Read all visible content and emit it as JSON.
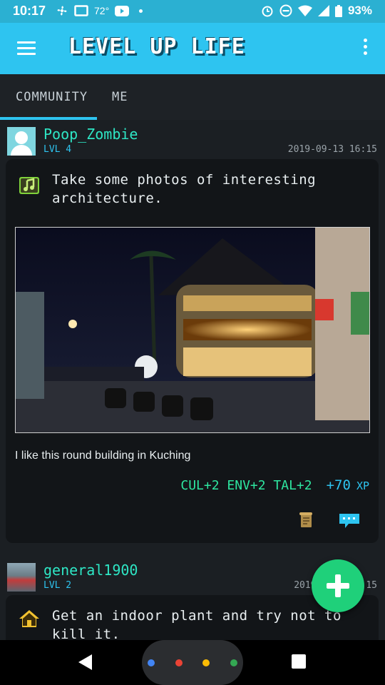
{
  "status_bar": {
    "time": "10:17",
    "temperature": "72°",
    "battery": "93%",
    "icons": [
      "fan-icon",
      "cast-icon",
      "youtube-icon",
      "dot-icon",
      "alarm-icon",
      "dnd-icon",
      "wifi-icon",
      "signal-icon",
      "battery-icon"
    ]
  },
  "app_bar": {
    "title": "LEVEL UP LIFE",
    "menu_icon": "menu-icon",
    "overflow_icon": "more-vert-icon"
  },
  "tabs": [
    {
      "label": "COMMUNITY",
      "selected": true
    },
    {
      "label": "ME",
      "selected": false
    }
  ],
  "posts": [
    {
      "username": "Poop_Zombie",
      "level": "LVL 4",
      "timestamp": "2019-09-13 16:15",
      "quest_icon": "music-note-icon",
      "quest_title": "Take some photos of interesting architecture.",
      "caption": "I like this round building in Kuching",
      "stats": "CUL+2 ENV+2 TAL+2",
      "xp_value": "+70",
      "xp_unit": "XP"
    },
    {
      "username": "general1900",
      "level": "LVL 2",
      "timestamp": "2019-",
      "timestamp_tail": "15",
      "quest_icon": "house-icon",
      "quest_title": "Get an indoor plant and try not to kill it."
    }
  ],
  "fab": {
    "icon": "add-icon"
  },
  "colors": {
    "status_bar": "#2bb0d2",
    "app_bar": "#2ec4f0",
    "background": "#1b1f23",
    "card": "#121518",
    "username": "#2ee6c5",
    "stats": "#2ee6a0",
    "fab": "#1fd07a"
  },
  "nav_bar": {
    "icons": [
      "back-icon",
      "home-icon",
      "recents-icon"
    ],
    "assistant_dot_colors": [
      "#4285f4",
      "#ea4335",
      "#fbbc05",
      "#34a853"
    ]
  }
}
